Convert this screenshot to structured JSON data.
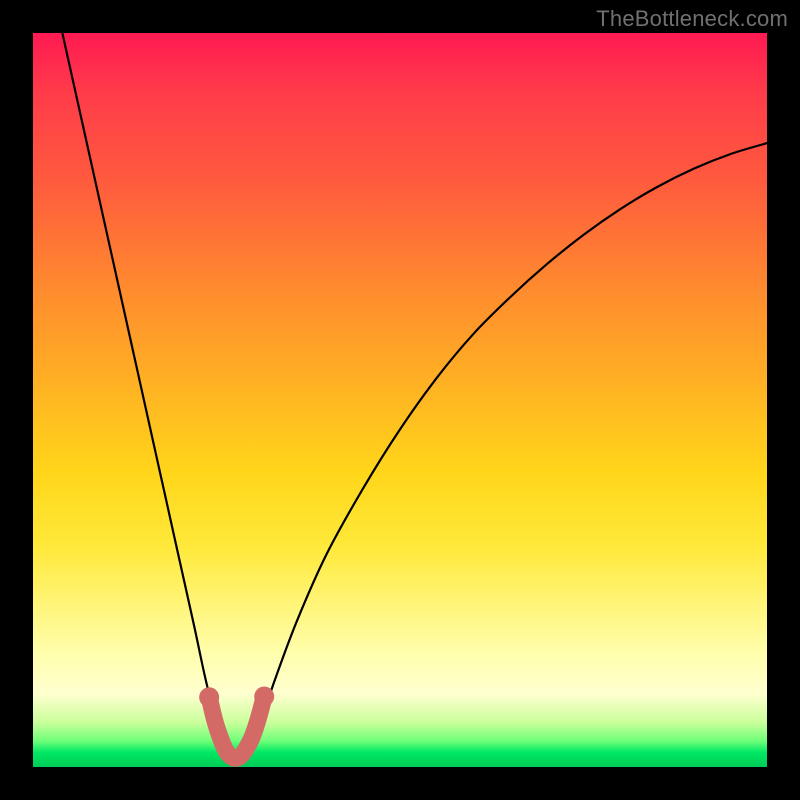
{
  "watermark": "TheBottleneck.com",
  "chart_data": {
    "type": "line",
    "title": "",
    "xlabel": "",
    "ylabel": "",
    "xlim": [
      0,
      100
    ],
    "ylim": [
      0,
      100
    ],
    "grid": false,
    "series": [
      {
        "name": "bottleneck-curve",
        "x": [
          4,
          6,
          8,
          10,
          12,
          14,
          16,
          18,
          20,
          22,
          23.5,
          25,
          26,
          27,
          28,
          29,
          30,
          31,
          33,
          36,
          40,
          45,
          50,
          55,
          60,
          65,
          70,
          75,
          80,
          85,
          90,
          95,
          100
        ],
        "y": [
          100,
          91,
          82,
          73,
          64,
          55,
          46,
          37,
          28,
          19,
          12,
          6,
          3,
          1.5,
          1,
          1.5,
          3,
          6,
          12,
          20,
          29,
          38,
          46,
          53,
          59,
          64,
          68.5,
          72.5,
          76,
          79,
          81.5,
          83.5,
          85
        ],
        "color": "#000000"
      },
      {
        "name": "optimal-marker",
        "x": [
          24.0,
          24.8,
          25.6,
          26.3,
          27.0,
          27.7,
          28.4,
          29.1,
          29.9,
          30.7,
          31.5
        ],
        "y": [
          9.5,
          6.2,
          3.8,
          2.2,
          1.4,
          1.2,
          1.6,
          2.6,
          4.2,
          6.6,
          9.6
        ],
        "color": "#d36a66"
      }
    ],
    "gradient_stops": [
      {
        "pos": 0,
        "color": "#ff1a52"
      },
      {
        "pos": 0.35,
        "color": "#ff8b2e"
      },
      {
        "pos": 0.6,
        "color": "#ffd61a"
      },
      {
        "pos": 0.85,
        "color": "#ffffb0"
      },
      {
        "pos": 0.97,
        "color": "#4cff6a"
      },
      {
        "pos": 1.0,
        "color": "#00cc55"
      }
    ]
  }
}
